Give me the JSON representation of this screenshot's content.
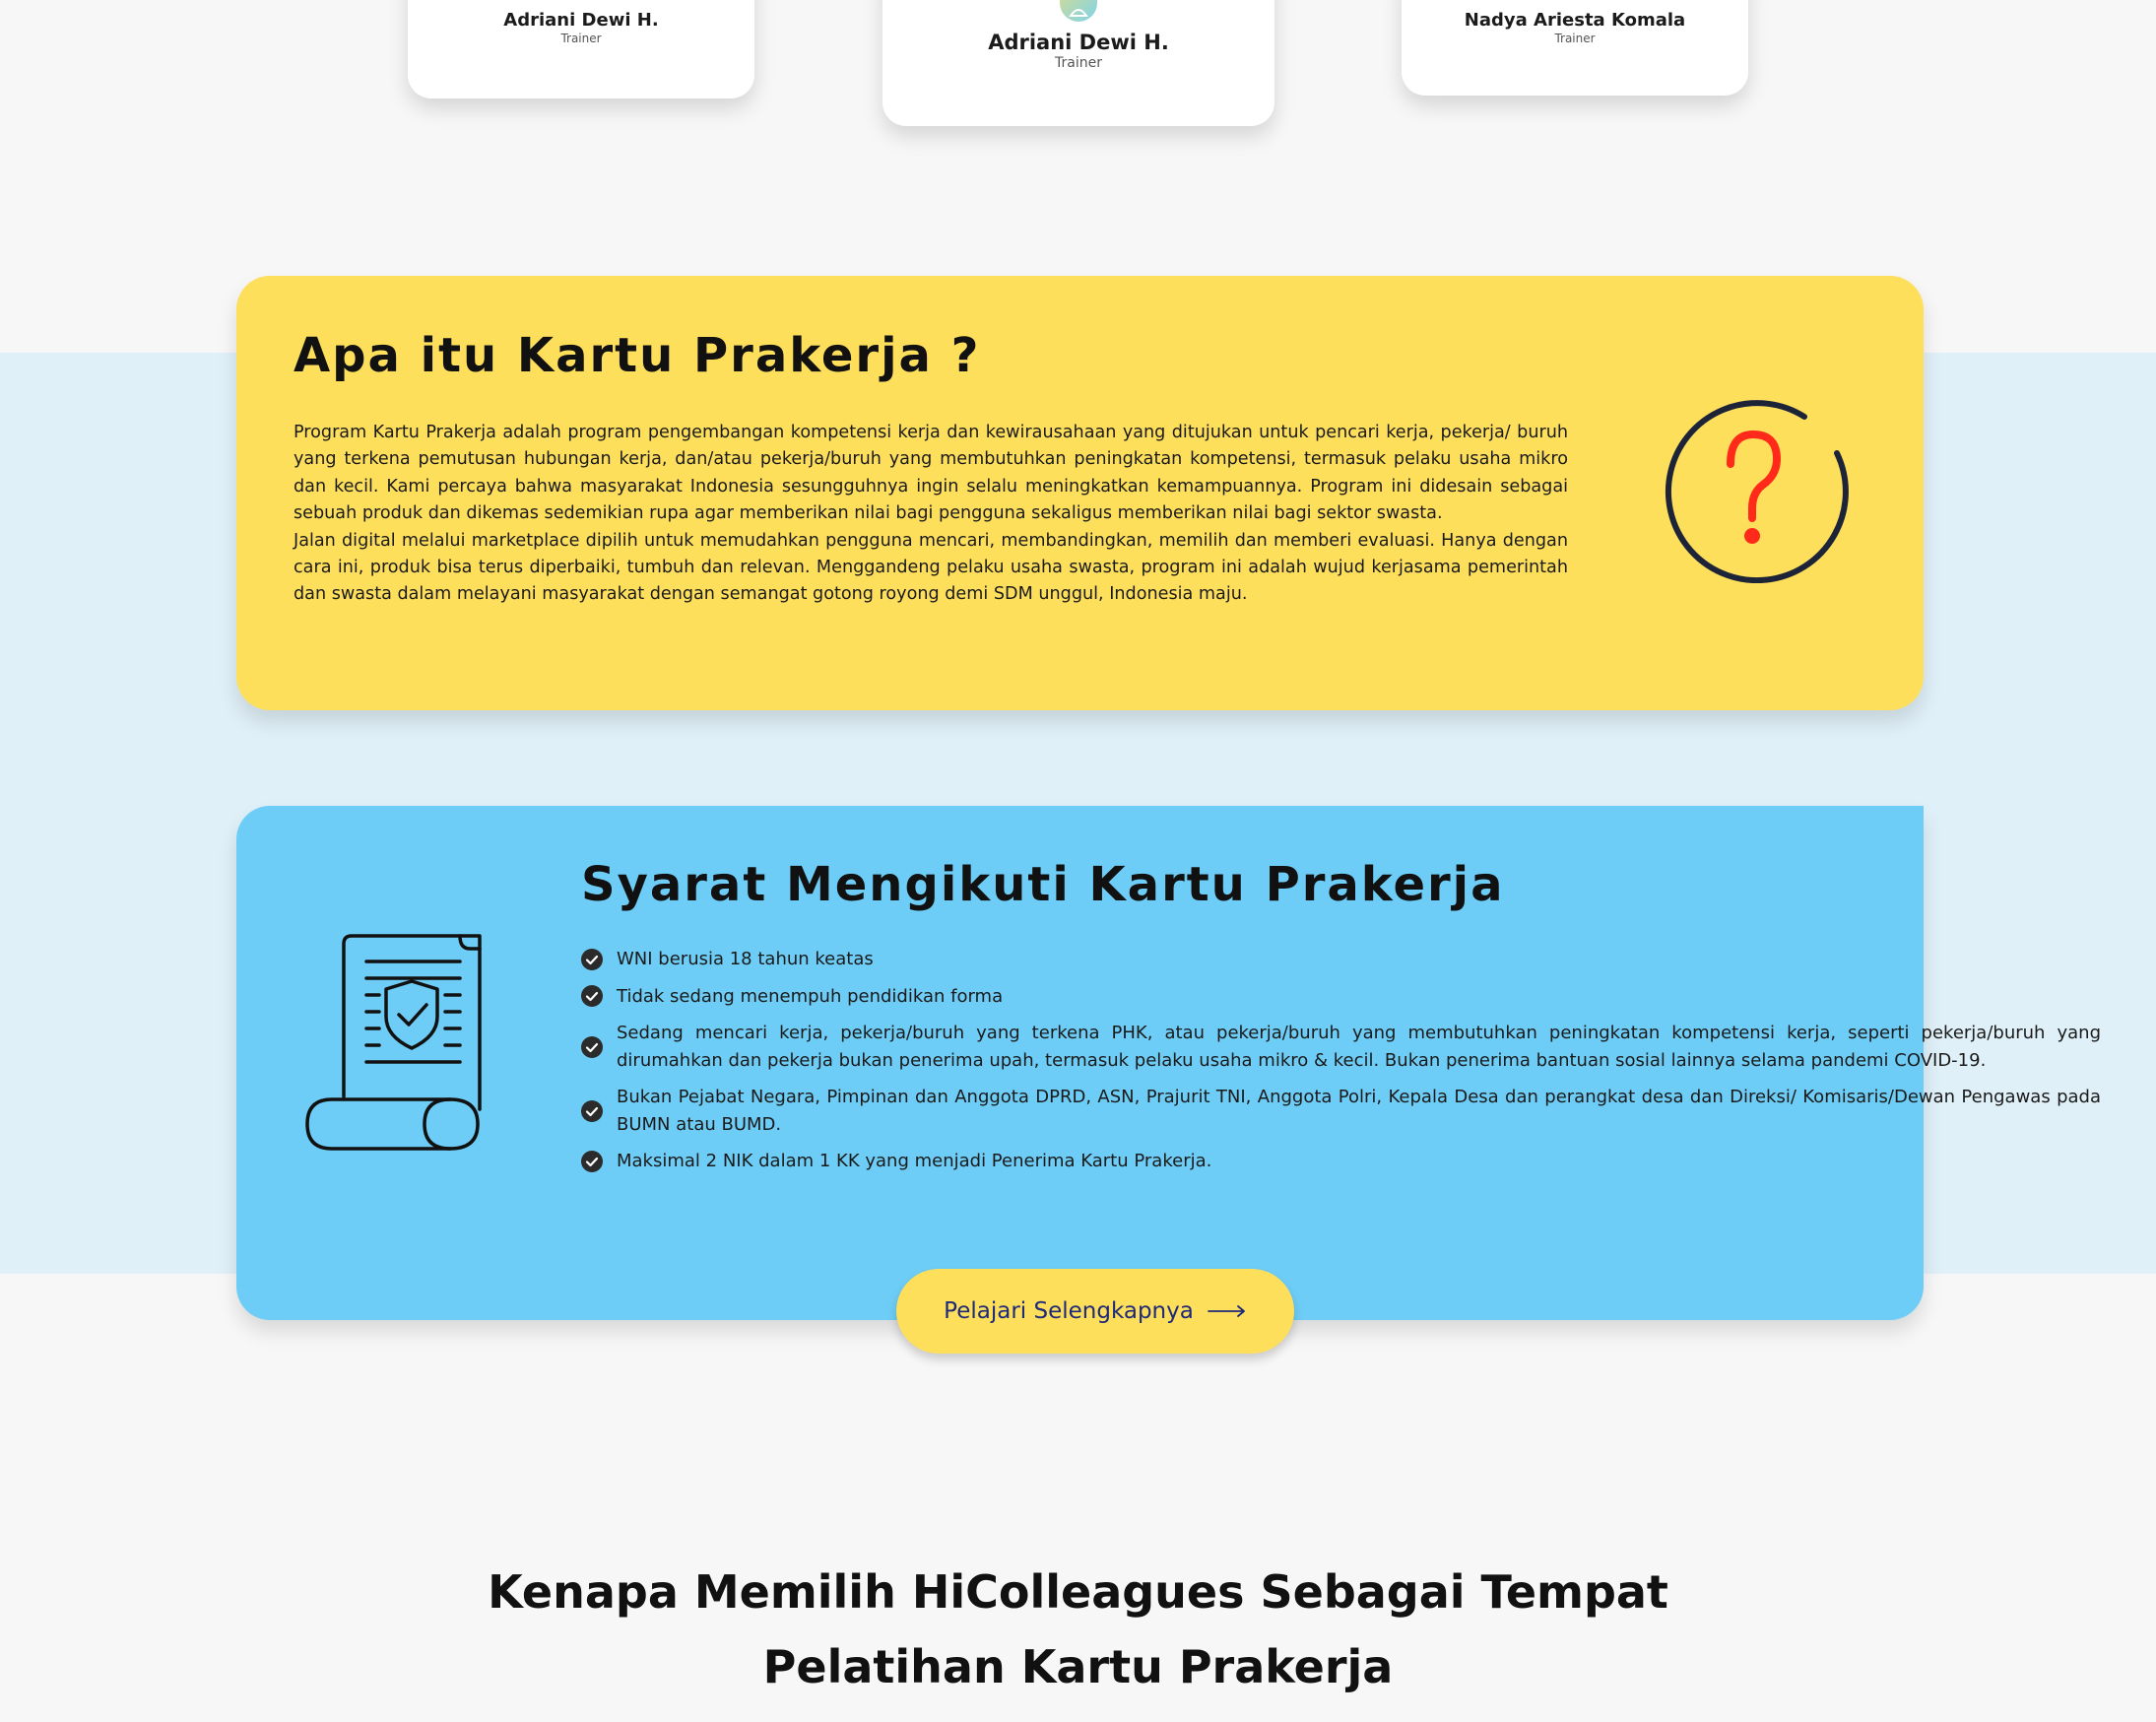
{
  "trainers": [
    {
      "name": "Adriani Dewi H.",
      "role": "Trainer"
    },
    {
      "name": "Adriani Dewi H.",
      "role": "Trainer"
    },
    {
      "name": "Nadya Ariesta Komala",
      "role": "Trainer"
    }
  ],
  "info": {
    "title": "Apa itu Kartu Prakerja ?",
    "paragraph_1": "Program Kartu Prakerja adalah program pengembangan kompetensi kerja dan kewirausahaan yang ditujukan untuk pencari kerja, pekerja/ buruh yang terkena pemutusan hubungan kerja, dan/atau pekerja/buruh yang membutuhkan peningkatan kompetensi, termasuk pelaku usaha mikro dan kecil. Kami percaya bahwa masyarakat Indonesia sesungguhnya ingin selalu meningkatkan kemampuannya. Program ini didesain sebagai sebuah produk dan dikemas sedemikian rupa agar memberikan nilai bagi pengguna sekaligus memberikan nilai bagi sektor swasta.",
    "paragraph_2": "Jalan digital melalui marketplace dipilih untuk memudahkan pengguna mencari, membandingkan, memilih dan memberi evaluasi. Hanya dengan cara ini, produk bisa terus diperbaiki, tumbuh dan relevan. Menggandeng pelaku usaha swasta, program ini adalah wujud kerjasama pemerintah dan swasta dalam melayani masyarakat dengan semangat gotong royong demi SDM unggul, Indonesia maju.",
    "icon": "question-circle-icon"
  },
  "requirements": {
    "title": "Syarat Mengikuti Kartu Prakerja",
    "icon": "document-shield-scroll-icon",
    "items": [
      "WNI berusia 18 tahun keatas",
      "Tidak sedang menempuh pendidikan forma",
      "Sedang mencari kerja, pekerja/buruh yang terkena PHK, atau pekerja/buruh yang membutuhkan peningkatan kompetensi kerja, seperti pekerja/buruh yang dirumahkan dan pekerja bukan penerima upah, termasuk pelaku usaha mikro & kecil. Bukan penerima bantuan sosial lainnya selama pandemi COVID-19.",
      "Bukan Pejabat Negara, Pimpinan dan Anggota DPRD, ASN, Prajurit TNI, Anggota Polri, Kepala Desa dan perangkat desa dan Direksi/ Komisaris/Dewan Pengawas pada BUMN atau BUMD.",
      "Maksimal 2 NIK dalam 1 KK yang menjadi Penerima Kartu Prakerja."
    ],
    "button_label": "Pelajari Selengkapnya"
  },
  "why": {
    "title_line_1": "Kenapa Memilih HiColleagues  Sebagai Tempat",
    "title_line_2": "Pelatihan Kartu Prakerja"
  },
  "colors": {
    "background": "#f7f7f7",
    "band": "#e0f0f8",
    "yellow": "#fedf5c",
    "blue": "#6ecdf6",
    "question_mark": "#ff2a1a",
    "icon_dark": "#1d2438",
    "button_text": "#1e2a78"
  }
}
